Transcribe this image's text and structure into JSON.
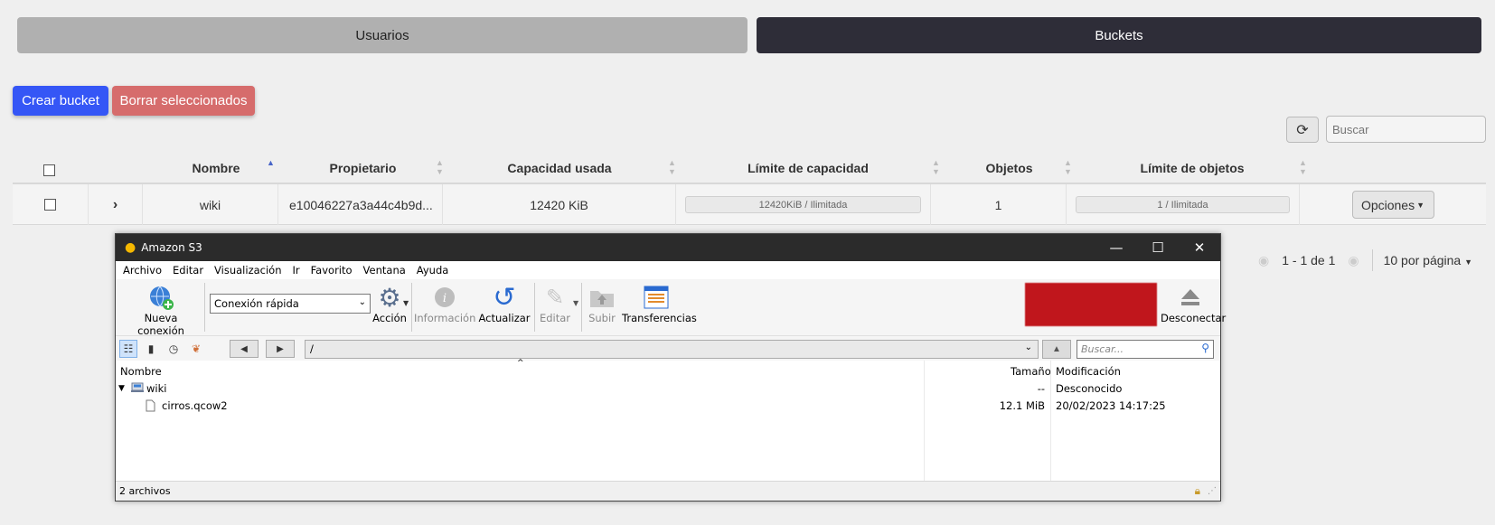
{
  "tabs": {
    "users": "Usuarios",
    "buckets": "Buckets"
  },
  "actions": {
    "create": "Crear bucket",
    "delete_selected": "Borrar seleccionados"
  },
  "search": {
    "placeholder": "Buscar"
  },
  "table": {
    "headers": {
      "name": "Nombre",
      "owner": "Propietario",
      "used": "Capacidad usada",
      "capacity_limit": "Límite de capacidad",
      "objects": "Objetos",
      "objects_limit": "Límite de objetos"
    },
    "rows": [
      {
        "name": "wiki",
        "owner": "e10046227a3a44c4b9d...",
        "used": "12420 KiB",
        "capacity_limit": "12420KiB / Ilimitada",
        "objects": "1",
        "objects_limit": "1 / Ilimitada",
        "options": "Opciones"
      }
    ]
  },
  "pagination": {
    "range": "1 - 1 de 1",
    "per_page": "10 por página"
  },
  "window": {
    "title": "Amazon S3",
    "menu": [
      "Archivo",
      "Editar",
      "Visualización",
      "Ir",
      "Favorito",
      "Ventana",
      "Ayuda"
    ],
    "toolbar": {
      "new_connection": "Nueva conexión",
      "quick_connect": "Conexión rápida",
      "action": "Acción",
      "info": "Información",
      "refresh": "Actualizar",
      "edit": "Editar",
      "upload": "Subir",
      "transfers": "Transferencias",
      "disconnect": "Desconectar"
    },
    "path": "/",
    "search_placeholder": "Buscar...",
    "columns": {
      "name": "Nombre",
      "size": "Tamaño",
      "modified": "Modificación"
    },
    "files": [
      {
        "name": "wiki",
        "size": "--",
        "modified": "Desconocido"
      },
      {
        "name": "cirros.qcow2",
        "size": "12.1 MiB",
        "modified": "20/02/2023 14:17:25"
      }
    ],
    "status": "2 archivos"
  }
}
